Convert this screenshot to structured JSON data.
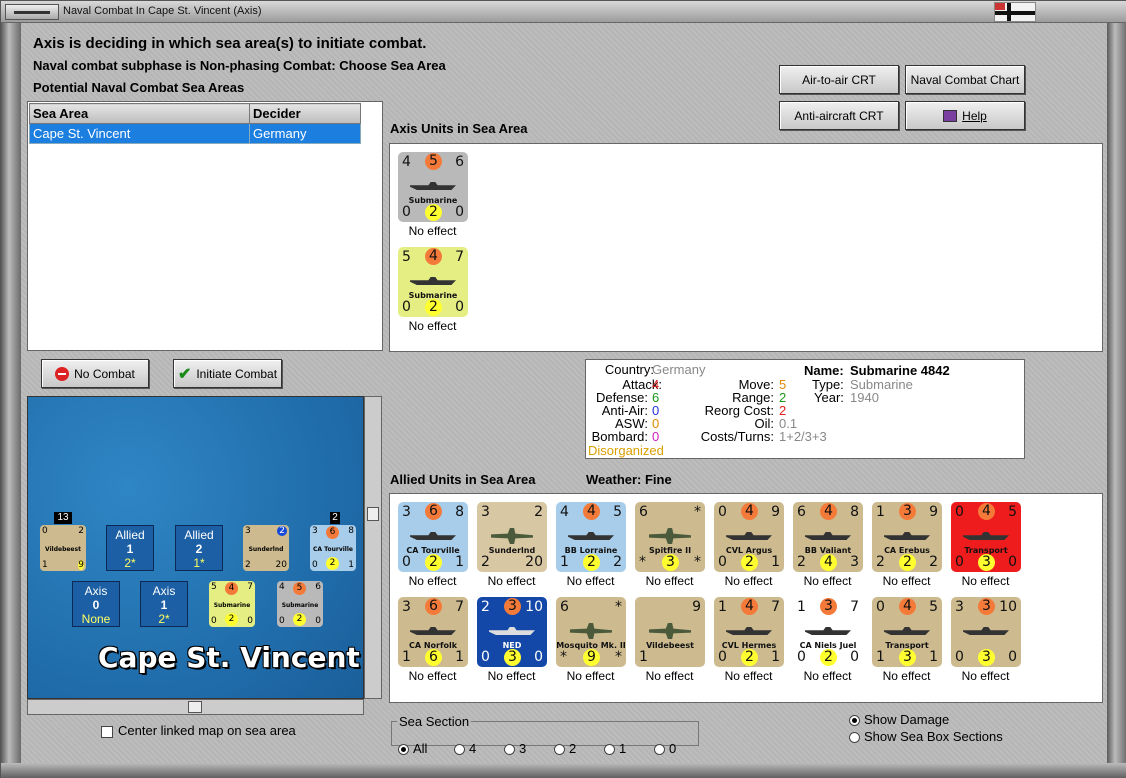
{
  "window": {
    "title": "Naval Combat In Cape St. Vincent (Axis)"
  },
  "messages": {
    "line1": "Axis is deciding in which sea area(s) to initiate combat.",
    "line2": "Naval combat subphase is Non-phasing Combat: Choose Sea Area",
    "line3": "Potential Naval Combat Sea Areas"
  },
  "sea_table": {
    "headers": [
      "Sea Area",
      "Decider"
    ],
    "rows": [
      [
        "Cape St. Vincent",
        "Germany"
      ]
    ]
  },
  "buttons": {
    "air_to_air": "Air-to-air CRT",
    "naval_chart": "Naval Combat Chart",
    "anti_aircraft": "Anti-aircraft CRT",
    "help": "Help",
    "no_combat": "No Combat",
    "initiate_combat": "Initiate Combat"
  },
  "axis_panel": {
    "title": "Axis Units in Sea Area",
    "units": [
      {
        "tl": "4",
        "tm": "5",
        "tr": "6",
        "name": "Submarine",
        "bl": "0",
        "bm": "2",
        "br": "0",
        "bg": "#b9b9b9",
        "effect": "No effect"
      },
      {
        "tl": "5",
        "tm": "4",
        "tr": "7",
        "name": "Submarine",
        "bl": "0",
        "bm": "2",
        "br": "0",
        "bg": "#e4ee82",
        "effect": "No effect"
      }
    ]
  },
  "unit_info": {
    "country_label": "Country:",
    "country": "Germany",
    "attack_label": "Attack:",
    "attack": "4",
    "defense_label": "Defense:",
    "defense": "6",
    "antiair_label": "Anti-Air:",
    "antiair": "0",
    "asw_label": "ASW:",
    "asw": "0",
    "bombard_label": "Bombard:",
    "bombard": "0",
    "status": "Disorganized",
    "move_label": "Move:",
    "move": "5",
    "range_label": "Range:",
    "range": "2",
    "reorg_label": "Reorg Cost:",
    "reorg": "2",
    "oil_label": "Oil:",
    "oil": "0.1",
    "costs_label": "Costs/Turns:",
    "costs": "1+2/3+3",
    "name_label": "Name:",
    "name": "Submarine 4842",
    "type_label": "Type:",
    "type": "Submarine",
    "year_label": "Year:",
    "year": "1940"
  },
  "allied_panel": {
    "title": "Allied Units in Sea Area",
    "weather": "Weather:  Fine",
    "units": [
      {
        "tl": "3",
        "tm": "6",
        "tr": "8",
        "name": "CA Tourville",
        "bl": "0",
        "bm": "2",
        "br": "1",
        "bg": "#a8cdea",
        "effect": "No effect",
        "kind": "ship"
      },
      {
        "tl": "3",
        "tm": "",
        "tr": "2",
        "name": "Sunderlnd",
        "bl": "2",
        "bm": "",
        "br": "20",
        "bg": "#d8c7a3",
        "effect": "No effect",
        "kind": "plane"
      },
      {
        "tl": "4",
        "tm": "4",
        "tr": "5",
        "name": "BB Lorraine",
        "bl": "1",
        "bm": "2",
        "br": "2",
        "bg": "#a8cdea",
        "effect": "No effect",
        "kind": "ship"
      },
      {
        "tl": "6",
        "tm": "",
        "tr": "*",
        "name": "Spitfire II",
        "bl": "*",
        "bm": "3",
        "br": "*",
        "bg": "#cdbb8f",
        "effect": "No effect",
        "kind": "plane"
      },
      {
        "tl": "0",
        "tm": "4",
        "tr": "9",
        "name": "CVL Argus",
        "bl": "0",
        "bm": "2",
        "br": "1",
        "bg": "#cdbb8f",
        "effect": "No effect",
        "kind": "ship"
      },
      {
        "tl": "6",
        "tm": "4",
        "tr": "8",
        "name": "BB Valiant",
        "bl": "2",
        "bm": "4",
        "br": "3",
        "bg": "#cdbb8f",
        "effect": "No effect",
        "kind": "ship"
      },
      {
        "tl": "1",
        "tm": "3",
        "tr": "9",
        "name": "CA Erebus",
        "bl": "2",
        "bm": "2",
        "br": "2",
        "bg": "#cdbb8f",
        "effect": "No effect",
        "kind": "ship"
      },
      {
        "tl": "0",
        "tm": "4",
        "tr": "5",
        "name": "Transport",
        "bl": "0",
        "bm": "3",
        "br": "0",
        "bg": "#ee1c1c",
        "effect": "No effect",
        "kind": "ship"
      },
      {
        "tl": "3",
        "tm": "6",
        "tr": "7",
        "name": "CA Norfolk",
        "bl": "1",
        "bm": "6",
        "br": "1",
        "bg": "#cdbb8f",
        "effect": "No effect",
        "kind": "ship"
      },
      {
        "tl": "2",
        "tm": "3",
        "tr": "10",
        "name": "NED",
        "bl": "0",
        "bm": "3",
        "br": "0",
        "bg": "#1448a8",
        "effect": "No effect",
        "kind": "ship"
      },
      {
        "tl": "6",
        "tm": "",
        "tr": "*",
        "name": "Mosquito Mk. II",
        "bl": "*",
        "bm": "9",
        "br": "*",
        "bg": "#cdbb8f",
        "effect": "No effect",
        "kind": "plane"
      },
      {
        "tl": "",
        "tm": "",
        "tr": "9",
        "name": "Vildebeest",
        "bl": "1",
        "bm": "",
        "br": "",
        "bg": "#cdbb8f",
        "effect": "No effect",
        "kind": "plane"
      },
      {
        "tl": "1",
        "tm": "4",
        "tr": "7",
        "name": "CVL Hermes",
        "bl": "0",
        "bm": "2",
        "br": "1",
        "bg": "#cdbb8f",
        "effect": "No effect",
        "kind": "ship"
      },
      {
        "tl": "1",
        "tm": "3",
        "tr": "7",
        "name": "CA Niels Juel",
        "bl": "0",
        "bm": "2",
        "br": "0",
        "bg": "#ffffff",
        "effect": "No effect",
        "kind": "ship"
      },
      {
        "tl": "0",
        "tm": "4",
        "tr": "5",
        "name": "Transport",
        "bl": "1",
        "bm": "3",
        "br": "1",
        "bg": "#cdbb8f",
        "effect": "No effect",
        "kind": "ship"
      },
      {
        "tl": "3",
        "tm": "3",
        "tr": "10",
        "name": "",
        "bl": "0",
        "bm": "3",
        "br": "0",
        "bg": "#cdbb8f",
        "effect": "No effect",
        "kind": "ship"
      }
    ]
  },
  "map": {
    "sea_name": "Cape St. Vincent",
    "allied_boxes": [
      {
        "label": "Allied",
        "num": "1",
        "sub": "2*"
      },
      {
        "label": "Allied",
        "num": "2",
        "sub": "1*"
      }
    ],
    "axis_boxes": [
      {
        "label": "Axis",
        "num": "0",
        "sub": "None"
      },
      {
        "label": "Axis",
        "num": "1",
        "sub": "2*"
      }
    ],
    "stack_counts": [
      "13",
      "2"
    ],
    "center_label": "Center linked map on sea area"
  },
  "sea_section": {
    "title": "Sea Section",
    "options": [
      "All",
      "4",
      "3",
      "2",
      "1",
      "0"
    ],
    "selected": "All"
  },
  "options": {
    "show_damage": "Show Damage",
    "show_sea_box": "Show Sea Box Sections"
  }
}
